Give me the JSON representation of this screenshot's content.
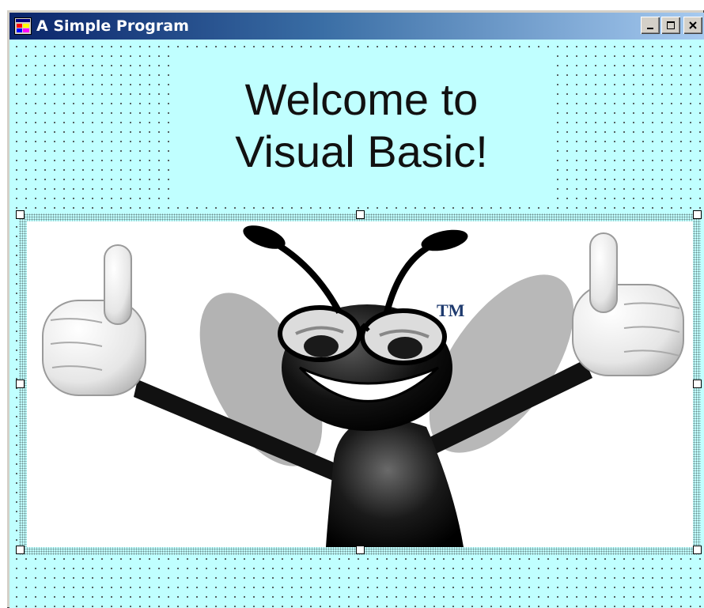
{
  "window": {
    "title": "A Simple Program",
    "app_icon": "vb-form-icon",
    "controls": {
      "minimize_icon": "minimize-icon",
      "maximize_icon": "maximize-icon",
      "close_icon": "close-icon"
    }
  },
  "form": {
    "background_color": "#c0ffff",
    "label": {
      "line1": "Welcome to",
      "line2": "Visual Basic!"
    },
    "picture": {
      "description_icon": "bug-mascot-image",
      "trademark": "TM"
    }
  }
}
